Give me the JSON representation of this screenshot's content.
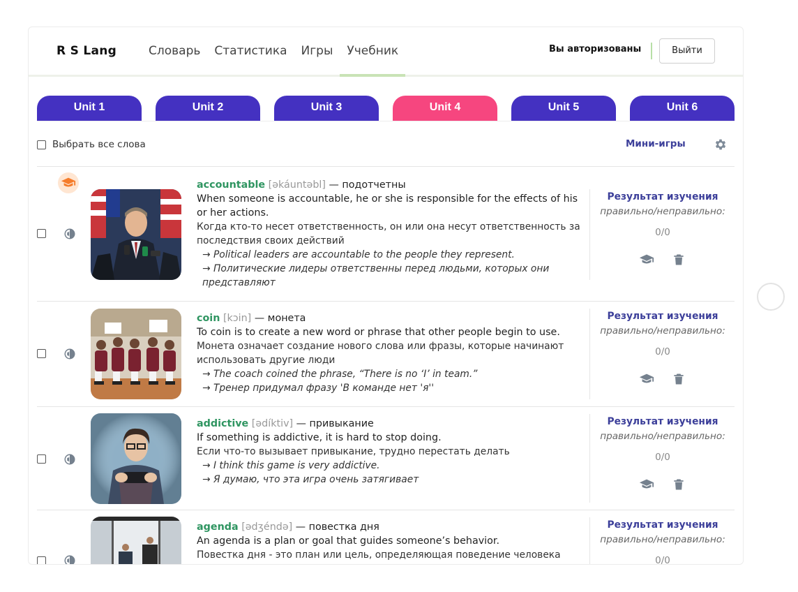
{
  "header": {
    "brand": "R S Lang",
    "nav": [
      "Словарь",
      "Статистика",
      "Игры",
      "Учебник"
    ],
    "active_nav": "Учебник",
    "auth_status": "Вы авторизованы",
    "logout_label": "Выйти"
  },
  "units": [
    {
      "label": "Unit 1",
      "color": "#4431c1"
    },
    {
      "label": "Unit 2",
      "color": "#4431c1"
    },
    {
      "label": "Unit 3",
      "color": "#4431c1"
    },
    {
      "label": "Unit 4",
      "color": "#f6467f"
    },
    {
      "label": "Unit 5",
      "color": "#4431c1"
    },
    {
      "label": "Unit 6",
      "color": "#4431c1"
    }
  ],
  "active_unit": "Unit 4",
  "toolbar": {
    "select_all_label": "Выбрать все слова",
    "mini_games_label": "Мини-игры",
    "settings_icon": "gear-icon"
  },
  "words": [
    {
      "word": "accountable",
      "transcription": "[əkáuntəbl]",
      "translation": "подотчетны",
      "meaning_en": "When someone is accountable, he or she is responsible for the effects of his or her actions.",
      "meaning_ru": "Когда кто-то несет ответственность, он или она несут ответственность за последствия своих действий",
      "example_en": "Political leaders are accountable to the people they represent.",
      "example_ru": "Политические лидеры ответственны перед людьми, которых они представляют",
      "learned": true,
      "result_title": "Результат изучения",
      "result_sub": "правильно/неправильно:",
      "result_score": "0/0"
    },
    {
      "word": "coin",
      "transcription": "[kɔin]",
      "translation": "монета",
      "meaning_en": "To coin is to create a new word or phrase that other people begin to use.",
      "meaning_ru": "Монета означает создание нового слова или фразы, которые начинают использовать другие люди",
      "example_en": "The coach coined the phrase, “There is no ‘I’ in team.”",
      "example_ru": "Тренер придумал фразу 'В команде нет 'я''",
      "learned": false,
      "result_title": "Результат изучения",
      "result_sub": "правильно/неправильно:",
      "result_score": "0/0"
    },
    {
      "word": "addictive",
      "transcription": "[ədíktiv]",
      "translation": "привыкание",
      "meaning_en": "If something is addictive, it is hard to stop doing.",
      "meaning_ru": "Если что-то вызывает привыкание, трудно перестать делать",
      "example_en": "I think this game is very addictive.",
      "example_ru": "Я думаю, что эта игра очень затягивает",
      "learned": false,
      "result_title": "Результат изучения",
      "result_sub": "правильно/неправильно:",
      "result_score": "0/0"
    },
    {
      "word": "agenda",
      "transcription": "[ədʒéndə]",
      "translation": "повестка дня",
      "meaning_en": "An agenda is a plan or goal that guides someone’s behavior.",
      "meaning_ru": "Повестка дня - это план или цель, определяющая поведение человека",
      "example_en": "",
      "example_ru": "",
      "learned": false,
      "result_title": "Результат изучения",
      "result_sub": "правильно/неправильно:",
      "result_score": "0/0"
    }
  ],
  "colors": {
    "accent": "#4431c1",
    "active_unit": "#f6467f",
    "word_green": "#2f9561",
    "result_title": "#3c3f9a"
  }
}
